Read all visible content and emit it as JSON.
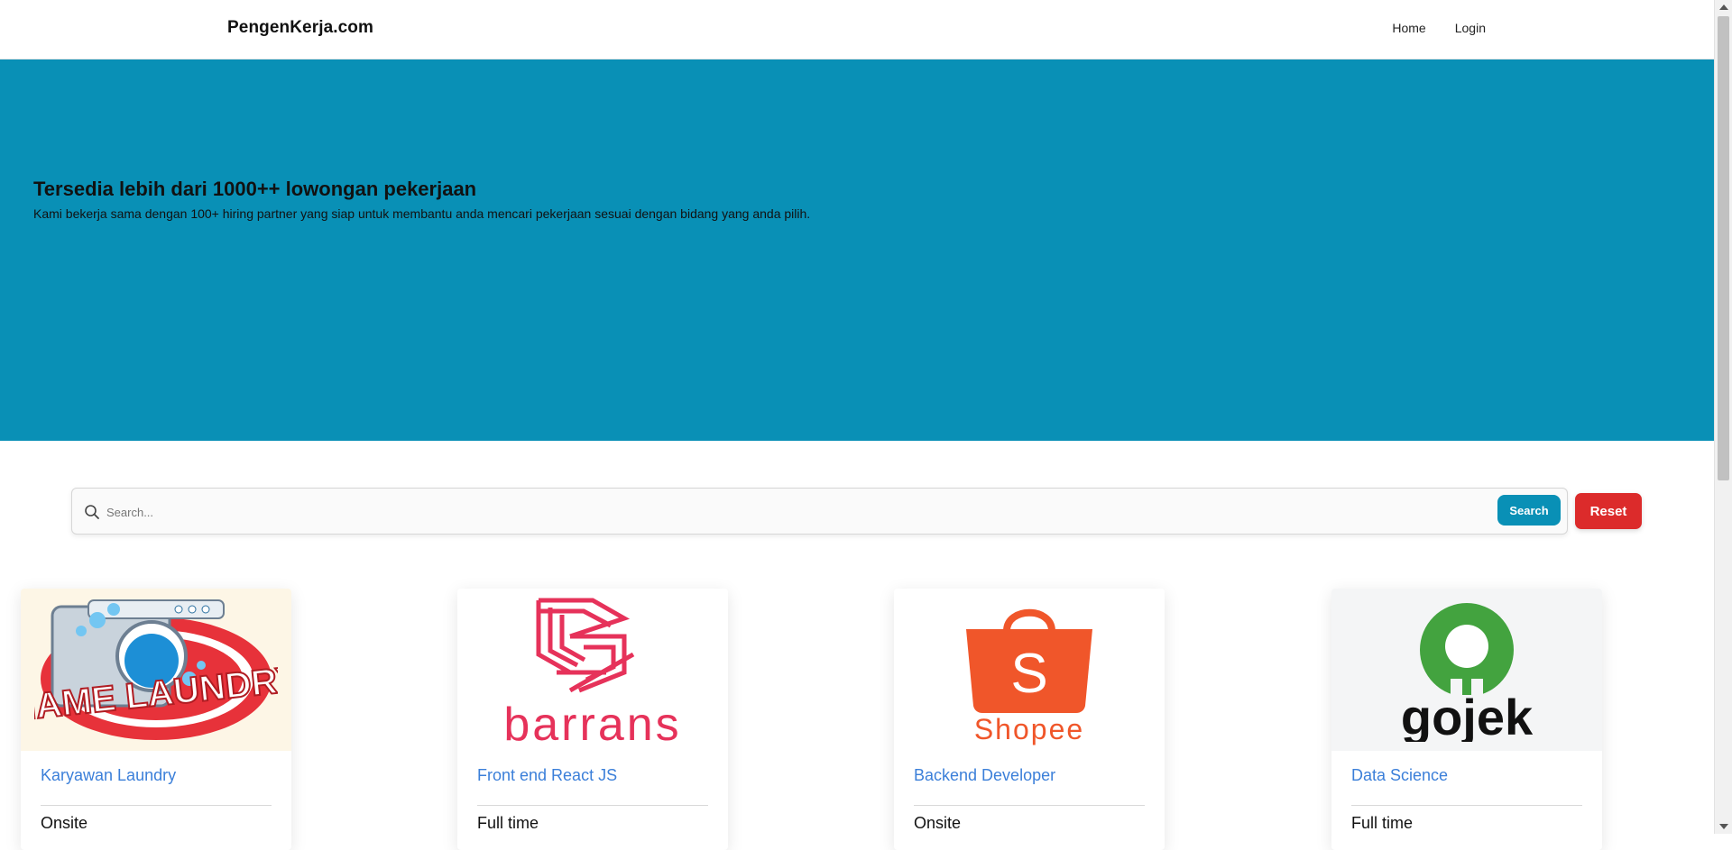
{
  "navbar": {
    "brand": "PengenKerja.com",
    "links": [
      {
        "label": "Home"
      },
      {
        "label": "Login"
      }
    ]
  },
  "hero": {
    "title": "Tersedia lebih dari 1000++ lowongan pekerjaan",
    "subtitle": "Kami bekerja sama dengan 100+ hiring partner yang siap untuk membantu anda mencari pekerjaan sesuai dengan bidang yang anda pilih."
  },
  "search": {
    "placeholder": "Search...",
    "value": "",
    "search_label": "Search",
    "reset_label": "Reset",
    "icon": "search-icon"
  },
  "jobs": [
    {
      "title": "Karyawan Laundry",
      "type": "Onsite",
      "logo": "laundry-logo",
      "logo_text": "NAME LAUNDRY"
    },
    {
      "title": "Front end React JS",
      "type": "Full time",
      "logo": "barrans-logo",
      "logo_text": "barrans"
    },
    {
      "title": "Backend Developer",
      "type": "Onsite",
      "logo": "shopee-logo",
      "logo_text": "Shopee"
    },
    {
      "title": "Data Science",
      "type": "Full time",
      "logo": "gojek-logo",
      "logo_text": "gojek"
    }
  ],
  "colors": {
    "primary": "#0990b6",
    "danger": "#dc2b2b",
    "link": "#3b7fd9"
  }
}
